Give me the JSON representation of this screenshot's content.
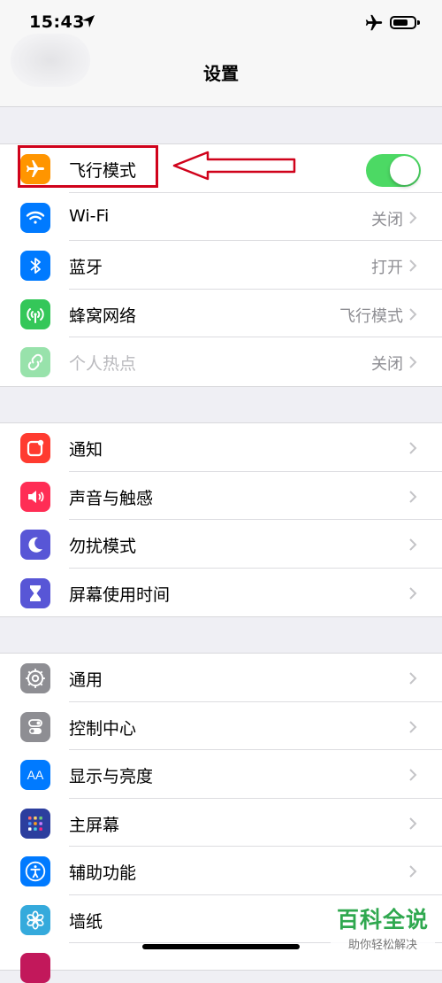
{
  "status_bar": {
    "time": "15:43"
  },
  "nav": {
    "title": "设置"
  },
  "groups": [
    {
      "rows": [
        {
          "label": "飞行模式",
          "icon": "airplane-icon",
          "color": "#ff9500",
          "toggle": true
        },
        {
          "label": "Wi-Fi",
          "value": "关闭",
          "icon": "wifi-icon",
          "color": "#007aff"
        },
        {
          "label": "蓝牙",
          "value": "打开",
          "icon": "bluetooth-icon",
          "color": "#007aff"
        },
        {
          "label": "蜂窝网络",
          "value": "飞行模式",
          "icon": "cellular-icon",
          "color": "#34c759"
        },
        {
          "label": "个人热点",
          "value": "关闭",
          "icon": "hotspot-icon",
          "color": "#34c759"
        }
      ]
    },
    {
      "rows": [
        {
          "label": "通知",
          "icon": "notifications-icon",
          "color": "#ff3b30"
        },
        {
          "label": "声音与触感",
          "icon": "sound-icon",
          "color": "#ff2d55"
        },
        {
          "label": "勿扰模式",
          "icon": "moon-icon",
          "color": "#5856d6"
        },
        {
          "label": "屏幕使用时间",
          "icon": "hourglass-icon",
          "color": "#5856d6"
        }
      ]
    },
    {
      "rows": [
        {
          "label": "通用",
          "icon": "gear-icon",
          "color": "#8e8e93"
        },
        {
          "label": "控制中心",
          "icon": "control-center-icon",
          "color": "#8e8e93"
        },
        {
          "label": "显示与亮度",
          "icon": "display-icon",
          "color": "#007aff"
        },
        {
          "label": "主屏幕",
          "icon": "home-screen-icon",
          "color": "#2c3e9e"
        },
        {
          "label": "辅助功能",
          "icon": "accessibility-icon",
          "color": "#007aff"
        },
        {
          "label": "墙纸",
          "icon": "wallpaper-icon",
          "color": "#35aadc"
        }
      ]
    }
  ],
  "watermark": {
    "main": "百科全说",
    "sub": "助你轻松解决"
  }
}
